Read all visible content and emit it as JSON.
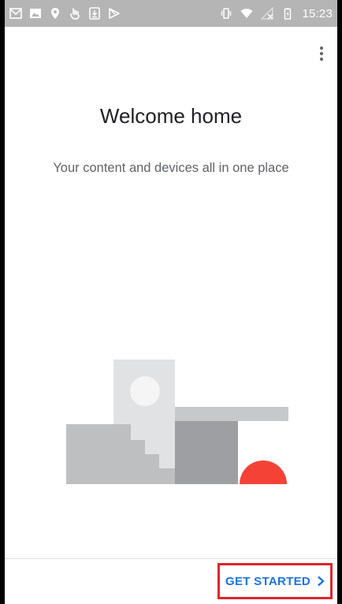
{
  "status_bar": {
    "time": "15:23",
    "left_icons": [
      "gmail-icon",
      "photos-icon",
      "location-icon",
      "touch-icon",
      "download-icon",
      "play-store-icon"
    ],
    "right_icons": [
      "vibrate-icon",
      "wifi-icon",
      "no-signal-icon",
      "battery-charging-icon"
    ]
  },
  "welcome": {
    "title": "Welcome home",
    "subtitle": "Your content and devices all in one place"
  },
  "actions": {
    "get_started_label": "GET STARTED"
  },
  "colors": {
    "accent": "#1a73e8",
    "highlight_box": "#e0242b",
    "status_bar": "#b5b5b5",
    "illustration_red": "#f44336"
  }
}
